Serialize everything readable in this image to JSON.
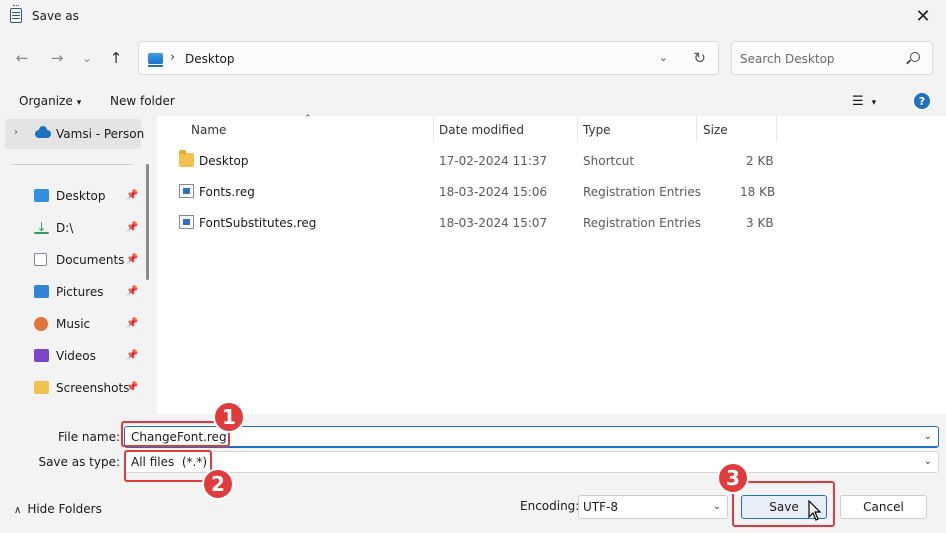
{
  "window": {
    "title": "Save as",
    "close_glyph": "✕"
  },
  "nav": {
    "back_glyph": "←",
    "forward_glyph": "→",
    "recent_glyph": "⌄",
    "up_glyph": "↑",
    "address_sep": "›",
    "address_location": "Desktop",
    "address_dd_glyph": "⌄",
    "refresh_glyph": "↻",
    "search_placeholder": "Search Desktop"
  },
  "commands": {
    "organize_label": "Organize",
    "new_folder_label": "New folder",
    "caret": "▾",
    "view_glyph": "☰",
    "help_glyph": "?"
  },
  "sidebar": {
    "onedrive_label": "Vamsi - Persona",
    "chev": "›",
    "pin_glyph": "📌",
    "items": [
      {
        "label": "Desktop",
        "icon": "desktop-icon",
        "color": "#2f8fe0"
      },
      {
        "label": "D:\\",
        "icon": "download-icon",
        "color": "#2f9e5a"
      },
      {
        "label": "Documents",
        "icon": "documents-icon",
        "color": "#7d8aa0"
      },
      {
        "label": "Pictures",
        "icon": "pictures-icon",
        "color": "#2f86d6"
      },
      {
        "label": "Music",
        "icon": "music-icon",
        "color": "#e0733a"
      },
      {
        "label": "Videos",
        "icon": "videos-icon",
        "color": "#7a45c8"
      },
      {
        "label": "Screenshots",
        "icon": "folder-icon",
        "color": "#f2c14e"
      }
    ]
  },
  "files": {
    "columns": {
      "name": "Name",
      "date": "Date modified",
      "type": "Type",
      "size": "Size"
    },
    "sort_glyph": "⌃",
    "rows": [
      {
        "name": "Desktop",
        "date": "17-02-2024 11:37",
        "type": "Shortcut",
        "size": "2 KB",
        "icon": "folder-shortcut-icon"
      },
      {
        "name": "Fonts.reg",
        "date": "18-03-2024 15:06",
        "type": "Registration Entries",
        "size": "18 KB",
        "icon": "reg-file-icon"
      },
      {
        "name": "FontSubstitutes.reg",
        "date": "18-03-2024 15:07",
        "type": "Registration Entries",
        "size": "3 KB",
        "icon": "reg-file-icon"
      }
    ]
  },
  "form": {
    "file_name_label": "File name:",
    "file_name_value": "ChangeFont.reg",
    "save_type_label": "Save as type:",
    "save_type_value": "All files  (*.*)",
    "dd_glyph": "⌄",
    "hide_folders_label": "Hide Folders",
    "hide_chev": "∧",
    "encoding_label": "Encoding:",
    "encoding_value": "UTF-8",
    "save_label": "Save",
    "cancel_label": "Cancel"
  },
  "annotations": {
    "one": "1",
    "two": "2",
    "three": "3",
    "color": "#e23b3b"
  }
}
